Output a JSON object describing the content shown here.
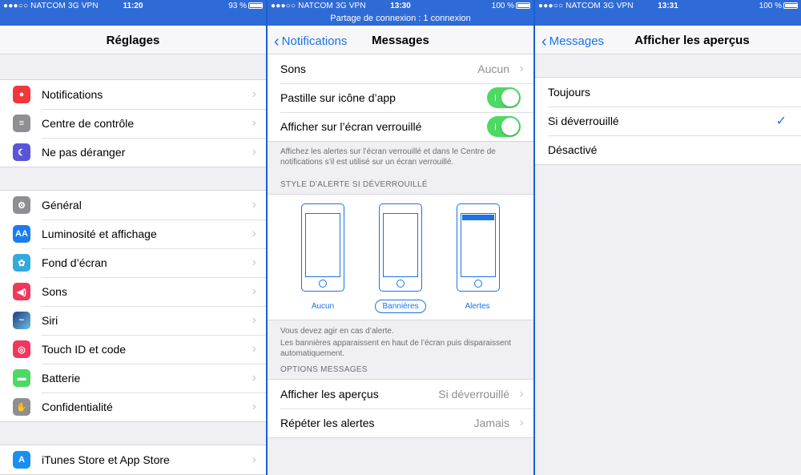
{
  "status": [
    {
      "carrier": "●●●○○ NATCOM",
      "net": "3G",
      "vpn": "VPN",
      "time": "11:20",
      "battery": "93 %",
      "level": 0.93
    },
    {
      "carrier": "●●●○○ NATCOM",
      "net": "3G",
      "vpn": "VPN",
      "time": "13:30",
      "battery": "100 %",
      "level": 1.0
    },
    {
      "carrier": "●●●○○ NATCOM",
      "net": "3G",
      "vpn": "VPN",
      "time": "13:31",
      "battery": "100 %",
      "level": 1.0
    }
  ],
  "tethering": "Partage de connexion : 1 connexion",
  "panel1": {
    "title": "Réglages",
    "group1": [
      {
        "label": "Notifications",
        "icon": "notifications-icon",
        "color": "#f2373c"
      },
      {
        "label": "Centre de contrôle",
        "icon": "control-center-icon",
        "color": "#8e8e93"
      },
      {
        "label": "Ne pas déranger",
        "icon": "moon-icon",
        "color": "#5856d6"
      }
    ],
    "group2": [
      {
        "label": "Général",
        "icon": "gear-icon",
        "color": "#8e8e93"
      },
      {
        "label": "Luminosité et affichage",
        "icon": "brightness-icon",
        "color": "#1a7cf2"
      },
      {
        "label": "Fond d’écran",
        "icon": "wallpaper-icon",
        "color": "#34aadc"
      },
      {
        "label": "Sons",
        "icon": "sound-icon",
        "color": "#f2375c"
      },
      {
        "label": "Siri",
        "icon": "siri-icon",
        "color": "#223a7a"
      },
      {
        "label": "Touch ID et code",
        "icon": "fingerprint-icon",
        "color": "#f2375c"
      },
      {
        "label": "Batterie",
        "icon": "battery-icon",
        "color": "#4cd964"
      },
      {
        "label": "Confidentialité",
        "icon": "hand-icon",
        "color": "#8e8e93"
      }
    ],
    "group3": [
      {
        "label": "iTunes Store et App Store",
        "icon": "app-store-icon",
        "color": "#1a8ff2"
      }
    ]
  },
  "panel2": {
    "back": "Notifications",
    "title": "Messages",
    "rows": [
      {
        "label": "Sons",
        "value": "Aucun"
      },
      {
        "label": "Pastille sur icône d’app",
        "toggle": true
      },
      {
        "label": "Afficher sur l’écran verrouillé",
        "toggle": true
      }
    ],
    "lock_footer": "Affichez les alertes sur l’écran verrouillé et dans le Centre de notifications s’il est utilisé sur un écran verrouillé.",
    "style_header": "STYLE D’ALERTE SI DÉVERROUILLÉ",
    "styles": [
      "Aucun",
      "Bannières",
      "Alertes"
    ],
    "style_selected": "Bannières",
    "style_footer_1": "Vous devez agir en cas d’alerte.",
    "style_footer_2": "Les bannières apparaissent en haut de l’écran puis disparaissent automatiquement.",
    "options_header": "OPTIONS MESSAGES",
    "options": [
      {
        "label": "Afficher les aperçus",
        "value": "Si déverrouillé"
      },
      {
        "label": "Répéter les alertes",
        "value": "Jamais"
      }
    ]
  },
  "panel3": {
    "back": "Messages",
    "title": "Afficher les aperçus",
    "options": [
      "Toujours",
      "Si déverrouillé",
      "Désactivé"
    ],
    "selected": "Si déverrouillé"
  }
}
